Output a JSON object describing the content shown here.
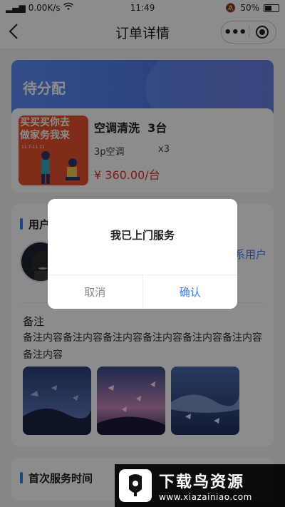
{
  "status_bar": {
    "network": "0.00K/s",
    "time": "11:49",
    "battery": "50%"
  },
  "nav": {
    "title": "订单详情",
    "more": "•••"
  },
  "order_status": {
    "label": "待分配"
  },
  "product": {
    "name": "空调清洗",
    "count": "3台",
    "spec": "3p空调",
    "qty": "x3",
    "price": "¥ 360.00/台",
    "image_text": [
      "买买买你去",
      "做家务我来",
      "11.7-11.11"
    ]
  },
  "user_section": {
    "title": "用户",
    "contact": "系用户",
    "note_title": "备注",
    "note_text": "备注内容备注内容备注内容备注内容备注内容备注内容备注内容"
  },
  "service_section": {
    "title": "首次服务时间"
  },
  "dialog": {
    "message": "我已上门服务",
    "cancel": "取消",
    "confirm": "确认"
  },
  "watermark": {
    "cn": "下载鸟资源",
    "url": "www.xiazainiao.com"
  },
  "colors": {
    "accent": "#3b7cf0",
    "price": "#e0322c",
    "status_card": "#5b8ef5"
  }
}
